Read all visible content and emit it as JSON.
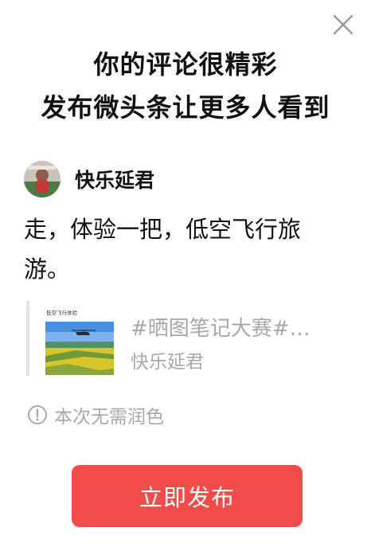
{
  "dialog": {
    "title_line1": "你的评论很精彩",
    "title_line2": "发布微头条让更多人看到",
    "close_icon": "close-icon"
  },
  "user": {
    "name": "快乐延君",
    "avatar_icon": "avatar"
  },
  "comment": {
    "text": "走，体验一把，低空飞行旅游。"
  },
  "quote": {
    "thumb_caption": "低空飞行体验",
    "title": "#晒图笔记大赛#…",
    "author": "快乐延君"
  },
  "notice": {
    "icon": "info-icon",
    "text": "本次无需润色"
  },
  "actions": {
    "publish_label": "立即发布"
  },
  "colors": {
    "accent": "#f24c4a",
    "muted_text": "#a8a8a8",
    "quote_bar": "#e4e4e4"
  }
}
